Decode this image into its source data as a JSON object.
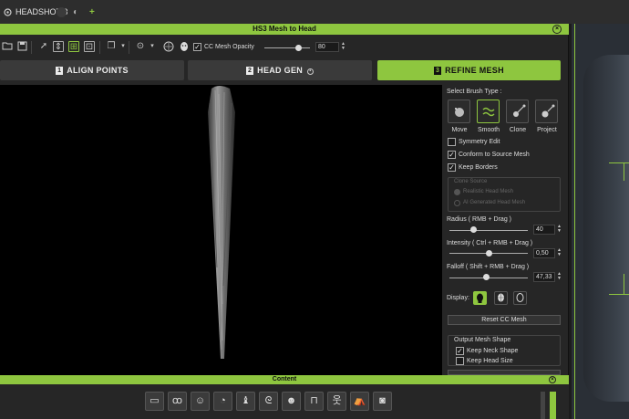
{
  "app": {
    "tab_label": "HEADSHOT 3",
    "tab_close": "×"
  },
  "dialog": {
    "title": "HS3 Mesh to Head",
    "close_glyph": "×",
    "toolbar": {
      "opacity_label": "CC Mesh Opacity",
      "opacity_value": "80",
      "opacity_fraction": 0.8
    },
    "steps": [
      {
        "num": "1",
        "label": "ALIGN POINTS",
        "active": false
      },
      {
        "num": "2",
        "label": "HEAD GEN",
        "active": false
      },
      {
        "num": "3",
        "label": "REFINE MESH",
        "active": true
      }
    ],
    "panel": {
      "brush_type_label": "Select Brush Type :",
      "brushes": [
        {
          "label": "Move",
          "icon": "move-brush-icon",
          "active": false
        },
        {
          "label": "Smooth",
          "icon": "smooth-brush-icon",
          "active": true
        },
        {
          "label": "Clone",
          "icon": "clone-brush-icon",
          "active": false
        },
        {
          "label": "Project",
          "icon": "project-brush-icon",
          "active": false
        }
      ],
      "symmetry_edit": "Symmetry Edit",
      "conform": "Conform to Source Mesh",
      "keep_borders": "Keep Borders",
      "clone_from_title": "Clone Source",
      "clone_opt1": "Realistic Head Mesh",
      "clone_opt2": "AI Generated Head Mesh",
      "radius_label": "Radius ( RMB + Drag )",
      "radius_value": "40",
      "radius_fraction": 0.3,
      "intensity_label": "Intensity ( Ctrl + RMB + Drag )",
      "intensity_value": "0,50",
      "intensity_fraction": 0.5,
      "falloff_label": "Falloff ( Shift + RMB + Drag )",
      "falloff_value": "47,33",
      "falloff_fraction": 0.47,
      "display_label": "Display:",
      "reset_label": "Reset CC Mesh",
      "output_title": "Output Mesh Shape",
      "keep_neck": "Keep Neck Shape",
      "keep_head_size": "Keep Head Size"
    }
  },
  "content": {
    "title": "Content",
    "close_glyph": "×"
  },
  "colors": {
    "accent": "#8ec63f",
    "panel": "#262626",
    "viewport": "#000000"
  }
}
